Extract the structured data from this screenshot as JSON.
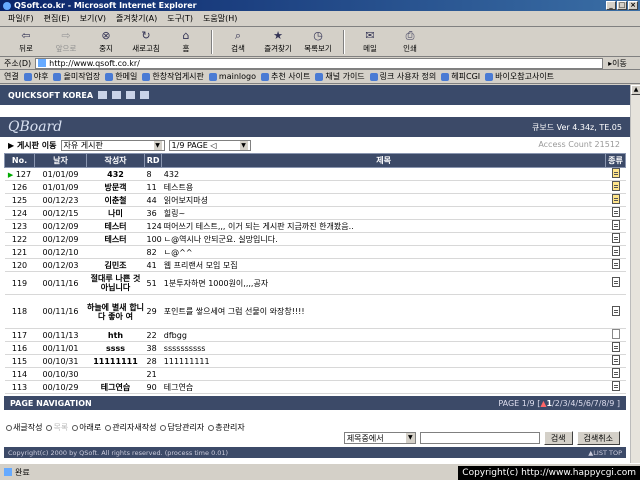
{
  "window": {
    "title": "QSoft.co.kr - Microsoft Internet Explorer"
  },
  "menu": [
    "파일(F)",
    "편집(E)",
    "보기(V)",
    "즐겨찾기(A)",
    "도구(T)",
    "도움말(H)"
  ],
  "toolbar": {
    "back": "뒤로",
    "forward": "앞으로",
    "stop": "중지",
    "refresh": "새로고침",
    "home": "홈",
    "search": "검색",
    "favorites": "즐겨찾기",
    "history": "목록보기",
    "mail": "메일",
    "print": "인쇄"
  },
  "address": {
    "label": "주소(D)",
    "url": "http://www.qsoft.co.kr/",
    "go": "이동"
  },
  "links": {
    "label": "연결",
    "items": [
      "야후",
      "올미작업장",
      "한메일",
      "한창작업게시판",
      "mainlogo",
      "추천 사이트",
      "채널 가이드",
      "링크 사용자 정의",
      "헤피CGI",
      "바이오참고사이트"
    ]
  },
  "site": {
    "header": "QUICKSOFT KOREA"
  },
  "board": {
    "logo": "QBoard",
    "version": "큐보드 Ver 4.34z, TE.05",
    "nav_label": "▶ 게시판 이동",
    "board_select": "자유 게시판",
    "page_select": "1/9 PAGE ◁",
    "access_count": "Access Count 21512",
    "columns": [
      "No.",
      "날자",
      "작성자",
      "RD",
      "제목",
      "종류"
    ],
    "rows": [
      {
        "no": "127",
        "date": "01/01/09",
        "author": "432",
        "rd": "8",
        "title": "432",
        "icon": "new"
      },
      {
        "no": "126",
        "date": "01/01/09",
        "author": "방문객",
        "rd": "11",
        "title": "테스트용",
        "icon": "new"
      },
      {
        "no": "125",
        "date": "00/12/23",
        "author": "이춘철",
        "rd": "44",
        "title": "읽어보지마셩",
        "icon": "new"
      },
      {
        "no": "124",
        "date": "00/12/15",
        "author": "나미",
        "rd": "36",
        "title": "힐링~",
        "icon": "doc"
      },
      {
        "no": "123",
        "date": "00/12/09",
        "author": "테스터",
        "rd": "124",
        "title": "떠어쓰기 테스트,,, 이거 되는 게시판 지금까진 한개봤음..",
        "icon": "doc"
      },
      {
        "no": "122",
        "date": "00/12/09",
        "author": "테스터",
        "rd": "100",
        "title": "ㄴ@역시나 안되군요. 실망입니다.",
        "icon": "doc"
      },
      {
        "no": "121",
        "date": "00/12/10",
        "author": "",
        "rd": "82",
        "title": "ㄴ@^^",
        "icon": "doc"
      },
      {
        "no": "120",
        "date": "00/12/03",
        "author": "김민조",
        "rd": "41",
        "title": "웹 프리랜서 모임 모집",
        "icon": "doc"
      },
      {
        "no": "119",
        "date": "00/11/16",
        "author": "절대루 나쁜 것 아닙니다",
        "rd": "51",
        "title": "1분투자하면 1000원이,,,,공자",
        "icon": "doc"
      },
      {
        "no": "118",
        "date": "00/11/16",
        "author": "하늘에 별새 합니다 좋아 여",
        "rd": "29",
        "title": "포인트를 쌓으세여 그럼 선물이 와장창!!!!",
        "icon": "doc"
      },
      {
        "no": "117",
        "date": "00/11/13",
        "author": "hth",
        "rd": "22",
        "title": "dfbgg",
        "icon": "blank"
      },
      {
        "no": "116",
        "date": "00/11/01",
        "author": "ssss",
        "rd": "38",
        "title": "ssssssssss",
        "icon": "doc"
      },
      {
        "no": "115",
        "date": "00/10/31",
        "author": "11111111",
        "rd": "28",
        "title": "111111111",
        "icon": "doc"
      },
      {
        "no": "114",
        "date": "00/10/30",
        "author": "",
        "rd": "21",
        "title": "",
        "icon": "doc"
      },
      {
        "no": "113",
        "date": "00/10/29",
        "author": "테그연습",
        "rd": "90",
        "title": "테그연습",
        "icon": "doc"
      }
    ],
    "page_nav_label": "PAGE NAVIGATION",
    "page_prefix": "PAGE 1/9 [",
    "current_page": "1",
    "other_pages": "/2/3/4/5/6/7/8/9 ]",
    "radios": [
      "새글작성",
      "목록",
      "아래로",
      "관리자새작성",
      "답당관리자",
      "총관리자"
    ],
    "search_select": "제목중에서",
    "search_button": "검색",
    "cancel_button": "검색취소",
    "copyright": "Copyright(c) 2000 by QSoft. All rights reserved. (process time 0.01)",
    "list_top": "▲LIST TOP"
  },
  "status": {
    "text": "완료"
  },
  "watermark": "Copyright(c) http://www.happycgi.com"
}
